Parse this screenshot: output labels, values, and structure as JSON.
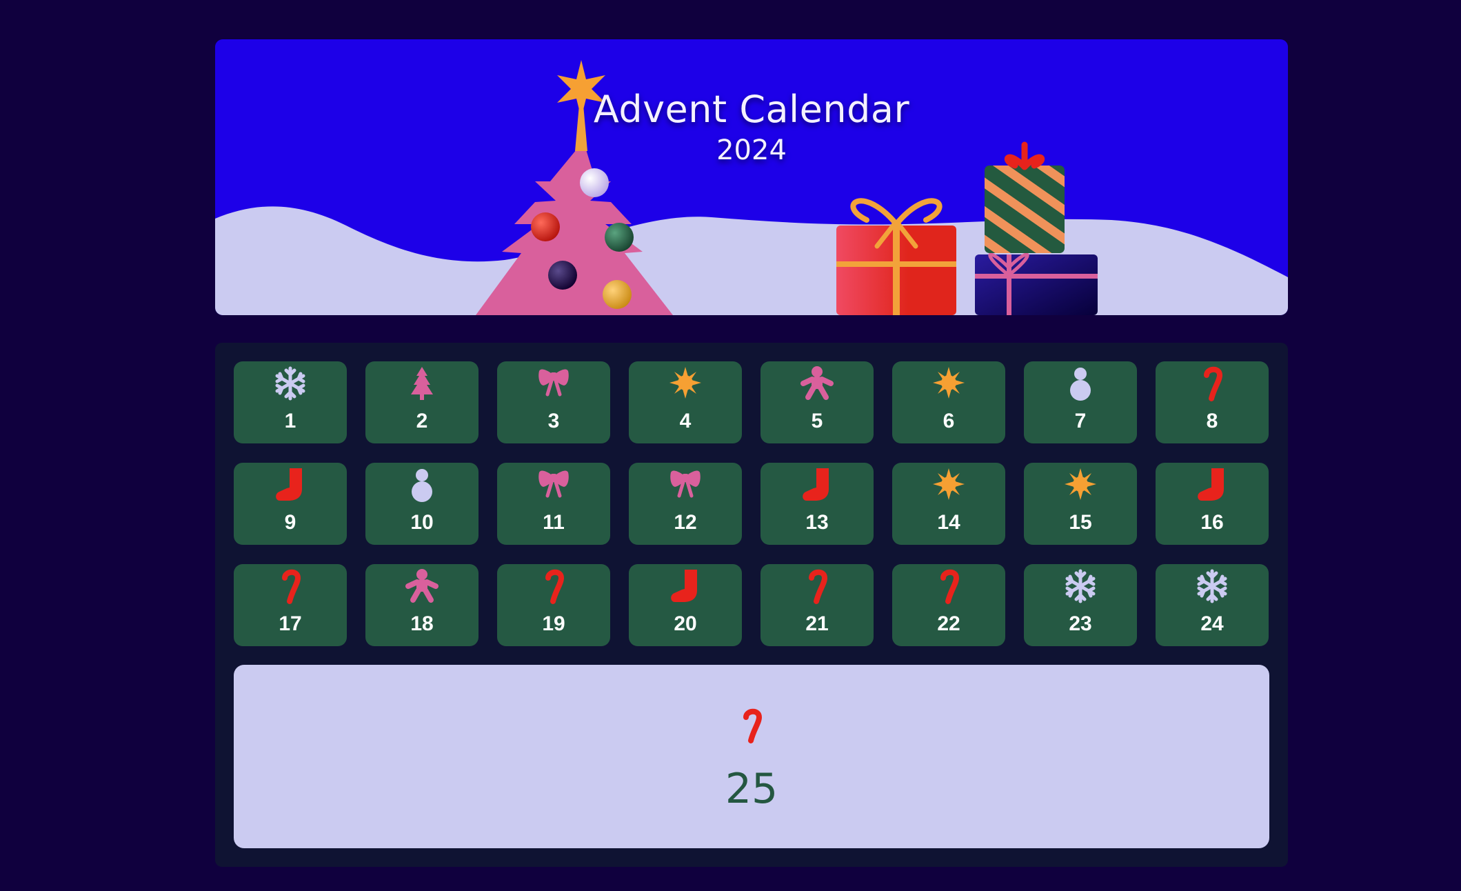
{
  "header": {
    "title": "Advent Calendar",
    "year": "2024"
  },
  "colors": {
    "background": "#10003e",
    "banner_sky": "#1d00e8",
    "snow": "#cbcbf1",
    "panel": "#0f1333",
    "door": "#255943",
    "final_door": "#cbcbf1",
    "final_number": "#245741"
  },
  "doors": [
    {
      "number": "1",
      "icon": "snowflake-icon"
    },
    {
      "number": "2",
      "icon": "tree-icon"
    },
    {
      "number": "3",
      "icon": "bow-icon"
    },
    {
      "number": "4",
      "icon": "star-icon"
    },
    {
      "number": "5",
      "icon": "gingerbread-icon"
    },
    {
      "number": "6",
      "icon": "star-icon"
    },
    {
      "number": "7",
      "icon": "snowman-icon"
    },
    {
      "number": "8",
      "icon": "candy-cane-icon"
    },
    {
      "number": "9",
      "icon": "stocking-icon"
    },
    {
      "number": "10",
      "icon": "snowman-icon"
    },
    {
      "number": "11",
      "icon": "bow-icon"
    },
    {
      "number": "12",
      "icon": "bow-icon"
    },
    {
      "number": "13",
      "icon": "stocking-icon"
    },
    {
      "number": "14",
      "icon": "star-icon"
    },
    {
      "number": "15",
      "icon": "star-icon"
    },
    {
      "number": "16",
      "icon": "stocking-icon"
    },
    {
      "number": "17",
      "icon": "candy-cane-icon"
    },
    {
      "number": "18",
      "icon": "gingerbread-icon"
    },
    {
      "number": "19",
      "icon": "candy-cane-icon"
    },
    {
      "number": "20",
      "icon": "stocking-icon"
    },
    {
      "number": "21",
      "icon": "candy-cane-icon"
    },
    {
      "number": "22",
      "icon": "candy-cane-icon"
    },
    {
      "number": "23",
      "icon": "snowflake-icon"
    },
    {
      "number": "24",
      "icon": "snowflake-icon"
    }
  ],
  "final_door": {
    "number": "25",
    "icon": "candy-cane-icon"
  }
}
